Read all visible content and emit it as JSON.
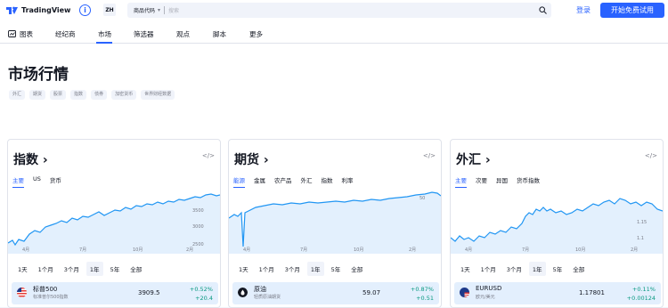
{
  "header": {
    "brand": "TradingView",
    "lang": "ZH",
    "search_type": "商品代码",
    "search_placeholder": "搜索",
    "login": "登录",
    "trial": "开始免费试用"
  },
  "nav": {
    "items": [
      "图表",
      "经纪商",
      "市场",
      "筛选器",
      "观点",
      "脚本",
      "更多"
    ],
    "active": "市场"
  },
  "page": {
    "title": "市场行情",
    "chips": [
      "外汇",
      "期货",
      "股票",
      "指数",
      "债券",
      "加密货币",
      "世界财经数据"
    ]
  },
  "panels": [
    {
      "title": "指数",
      "tabs": [
        "主要",
        "US",
        "货币"
      ],
      "active_tab": "主要",
      "x_labels": [
        "4月",
        "7月",
        "10月",
        "2月"
      ],
      "y_labels": [
        "3500",
        "3000",
        "2500"
      ],
      "ranges": [
        "1天",
        "1个月",
        "3个月",
        "1年",
        "5年",
        "全部"
      ],
      "active_range": "1年",
      "row": {
        "name": "标普500",
        "sub": "标准普尔500指数",
        "price": "3909.5",
        "pct": "+0.52%",
        "chg": "+20.4"
      }
    },
    {
      "title": "期货",
      "tabs": [
        "能源",
        "金属",
        "农产品",
        "外汇",
        "指数",
        "利率"
      ],
      "active_tab": "能源",
      "x_labels": [
        "4月",
        "7月",
        "10月",
        "2月"
      ],
      "y_labels": [
        "50"
      ],
      "ranges": [
        "1天",
        "1个月",
        "3个月",
        "1年",
        "5年",
        "全部"
      ],
      "active_range": "1年",
      "row": {
        "name": "原油",
        "sub": "轻质原油期货",
        "price": "59.07",
        "pct": "+0.87%",
        "chg": "+0.51"
      }
    },
    {
      "title": "外汇",
      "tabs": [
        "主要",
        "次要",
        "异国",
        "货币指数"
      ],
      "active_tab": "主要",
      "x_labels": [
        "4月",
        "7月",
        "10月",
        "2月"
      ],
      "y_labels": [
        "1.15",
        "1.1"
      ],
      "ranges": [
        "1天",
        "1个月",
        "3个月",
        "1年",
        "5年",
        "全部"
      ],
      "active_range": "1年",
      "row": {
        "name": "EURUSD",
        "sub": "欧元/美元",
        "price": "1.17801",
        "pct": "+0.11%",
        "chg": "+0.00124"
      }
    }
  ],
  "colors": {
    "accent": "#2962ff",
    "up": "#089981",
    "chart_line": "#2196f3",
    "chart_fill": "#e3f0fd"
  }
}
